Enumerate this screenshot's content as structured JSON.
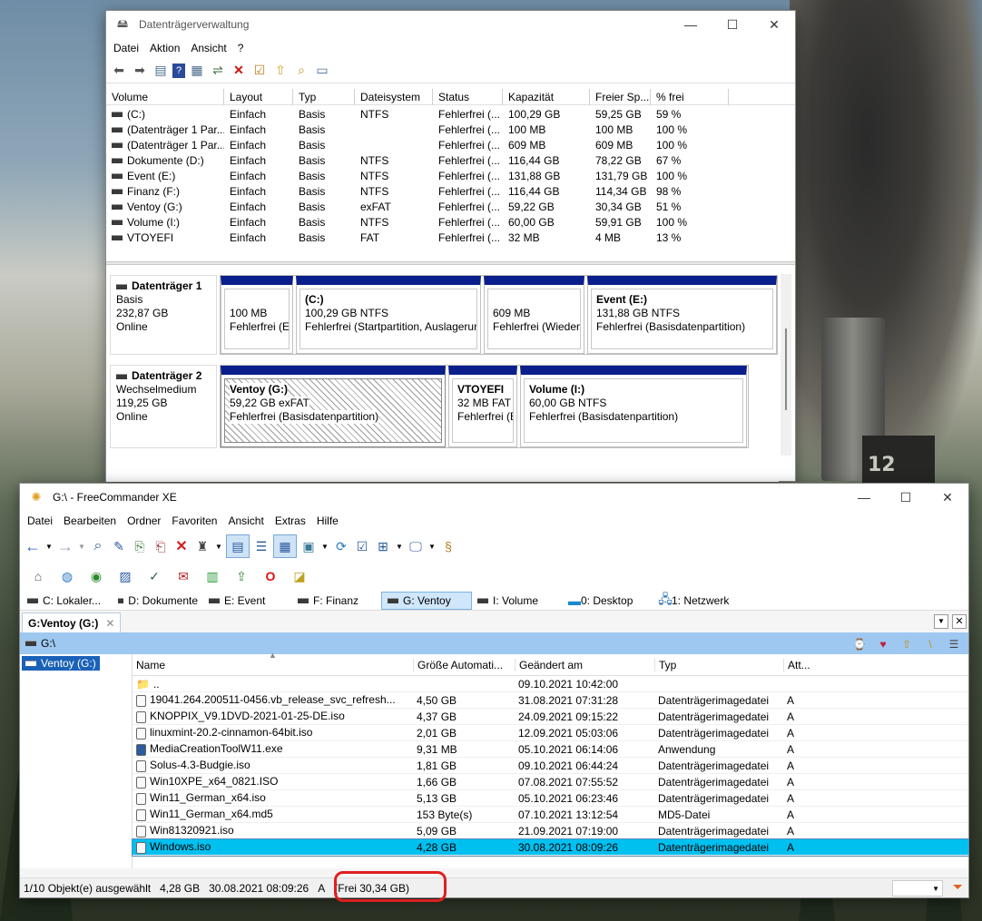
{
  "disk_mgmt": {
    "title": "Datenträgerverwaltung",
    "menu": [
      "Datei",
      "Aktion",
      "Ansicht",
      "?"
    ],
    "columns": [
      "Volume",
      "Layout",
      "Typ",
      "Dateisystem",
      "Status",
      "Kapazität",
      "Freier Sp...",
      "% frei"
    ],
    "rows": [
      [
        "(C:)",
        "Einfach",
        "Basis",
        "NTFS",
        "Fehlerfrei (...",
        "100,29 GB",
        "59,25 GB",
        "59 %"
      ],
      [
        "(Datenträger 1 Par...",
        "Einfach",
        "Basis",
        "",
        "Fehlerfrei (...",
        "100 MB",
        "100 MB",
        "100 %"
      ],
      [
        "(Datenträger 1 Par...",
        "Einfach",
        "Basis",
        "",
        "Fehlerfrei (...",
        "609 MB",
        "609 MB",
        "100 %"
      ],
      [
        "Dokumente (D:)",
        "Einfach",
        "Basis",
        "NTFS",
        "Fehlerfrei (...",
        "116,44 GB",
        "78,22 GB",
        "67 %"
      ],
      [
        "Event (E:)",
        "Einfach",
        "Basis",
        "NTFS",
        "Fehlerfrei (...",
        "131,88 GB",
        "131,79 GB",
        "100 %"
      ],
      [
        "Finanz (F:)",
        "Einfach",
        "Basis",
        "NTFS",
        "Fehlerfrei (...",
        "116,44 GB",
        "114,34 GB",
        "98 %"
      ],
      [
        "Ventoy (G:)",
        "Einfach",
        "Basis",
        "exFAT",
        "Fehlerfrei (...",
        "59,22 GB",
        "30,34 GB",
        "51 %"
      ],
      [
        "Volume (I:)",
        "Einfach",
        "Basis",
        "NTFS",
        "Fehlerfrei (...",
        "60,00 GB",
        "59,91 GB",
        "100 %"
      ],
      [
        "VTOYEFI",
        "Einfach",
        "Basis",
        "FAT",
        "Fehlerfrei (...",
        "32 MB",
        "4 MB",
        "13 %"
      ]
    ],
    "disk1": {
      "name": "Datenträger 1",
      "type": "Basis",
      "size": "232,87 GB",
      "state": "Online",
      "parts": [
        {
          "l1": "",
          "l2": "100 MB",
          "l3": "Fehlerfrei (EF"
        },
        {
          "l1": "(C:)",
          "l2": "100,29 GB NTFS",
          "l3": "Fehlerfrei (Startpartition, Auslagerun"
        },
        {
          "l1": "",
          "l2": "609 MB",
          "l3": "Fehlerfrei (Wiederh"
        },
        {
          "l1": "Event  (E:)",
          "l2": "131,88 GB NTFS",
          "l3": "Fehlerfrei (Basisdatenpartition)"
        }
      ]
    },
    "disk2": {
      "name": "Datenträger 2",
      "type": "Wechselmedium",
      "size": "119,25 GB",
      "state": "Online",
      "parts": [
        {
          "l1": "Ventoy  (G:)",
          "l2": "59,22 GB exFAT",
          "l3": "Fehlerfrei (Basisdatenpartition)"
        },
        {
          "l1": "VTOYEFI",
          "l2": "32 MB FAT",
          "l3": "Fehlerfrei (B"
        },
        {
          "l1": "Volume  (I:)",
          "l2": "60,00 GB NTFS",
          "l3": "Fehlerfrei (Basisdatenpartition)"
        }
      ]
    }
  },
  "fc": {
    "title": "G:\\ - FreeCommander XE",
    "menu": [
      "Datei",
      "Bearbeiten",
      "Ordner",
      "Favoriten",
      "Ansicht",
      "Extras",
      "Hilfe"
    ],
    "drive_tabs": [
      "C: Lokaler...",
      "D: Dokumente",
      "E: Event",
      "F: Finanz",
      "G: Ventoy",
      "I: Volume",
      "0: Desktop",
      "1: Netzwerk"
    ],
    "panel_tab": "G:Ventoy (G:)",
    "path": "G:\\",
    "tree_item": "Ventoy (G:)",
    "columns": [
      "Name",
      "Größe Automati...",
      "Geändert am",
      "Typ",
      "Att..."
    ],
    "files": [
      [
        "..",
        "",
        "09.10.2021 10:42:00",
        "",
        ""
      ],
      [
        "19041.264.200511-0456.vb_release_svc_refresh...",
        "4,50 GB",
        "31.08.2021 07:31:28",
        "Datenträgerimagedatei",
        "A"
      ],
      [
        "KNOPPIX_V9.1DVD-2021-01-25-DE.iso",
        "4,37 GB",
        "24.09.2021 09:15:22",
        "Datenträgerimagedatei",
        "A"
      ],
      [
        "linuxmint-20.2-cinnamon-64bit.iso",
        "2,01 GB",
        "12.09.2021 05:03:06",
        "Datenträgerimagedatei",
        "A"
      ],
      [
        "MediaCreationToolW11.exe",
        "9,31 MB",
        "05.10.2021 06:14:06",
        "Anwendung",
        "A"
      ],
      [
        "Solus-4.3-Budgie.iso",
        "1,81 GB",
        "09.10.2021 06:44:24",
        "Datenträgerimagedatei",
        "A"
      ],
      [
        "Win10XPE_x64_0821.ISO",
        "1,66 GB",
        "07.08.2021 07:55:52",
        "Datenträgerimagedatei",
        "A"
      ],
      [
        "Win11_German_x64.iso",
        "5,13 GB",
        "05.10.2021 06:23:46",
        "Datenträgerimagedatei",
        "A"
      ],
      [
        "Win11_German_x64.md5",
        "153 Byte(s)",
        "07.10.2021 13:12:54",
        "MD5-Datei",
        "A"
      ],
      [
        "Win81320921.iso",
        "5,09 GB",
        "21.09.2021 07:19:00",
        "Datenträgerimagedatei",
        "A"
      ],
      [
        "Windows.iso",
        "4,28 GB",
        "30.08.2021 08:09:26",
        "Datenträgerimagedatei",
        "A"
      ]
    ],
    "status": {
      "sel": "1/10 Objekt(e) ausgewählt",
      "size": "4,28 GB",
      "date": "30.08.2021 08:09:26",
      "attr": "A",
      "free": "(Frei 30,34 GB)"
    }
  },
  "colors": {
    "accent": "#0a1f8c",
    "selection": "#00c0f0",
    "highlight": "#e02020"
  }
}
